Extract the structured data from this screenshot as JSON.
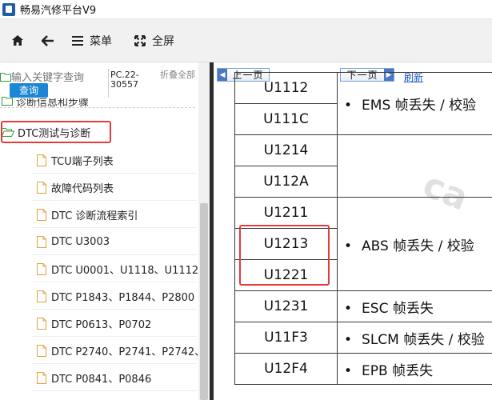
{
  "window": {
    "title": "畅易汽修平台V9"
  },
  "toolbar": {
    "menu_label": "菜单",
    "fullscreen_label": "全屏"
  },
  "search": {
    "placeholder": "输入关键字查询",
    "button_label": "查询",
    "pc_info": "PC.22-30557",
    "fold_all": "折叠全部"
  },
  "tree": {
    "partial_item": "诊断信息和步骤",
    "selected_folder": "DTC测试与诊断",
    "children": [
      "TCU端子列表",
      "故障代码列表",
      "DTC 诊断流程索引",
      "DTC U3003",
      "DTC U0001、U1118、U1112、",
      "DTC P1843、P1844、P2800",
      "DTC P0613、P0702",
      "DTC P2740、P2741、P2742、",
      "DTC P0841、P0846"
    ]
  },
  "nav": {
    "prev_label": "上一页",
    "next_label": "下一页",
    "refresh_label": "刷新"
  },
  "watermark": "ca",
  "dtc_table": {
    "groups": [
      {
        "codes": [
          "U1112",
          "U111C"
        ],
        "desc": "EMS 帧丢失 / 校验"
      },
      {
        "codes": [
          "U1214",
          "U112A"
        ],
        "desc": ""
      },
      {
        "codes": [
          "U1211",
          "U1213",
          "U1221"
        ],
        "desc": "ABS 帧丢失 / 校验"
      },
      {
        "codes": [
          "U1231"
        ],
        "desc": "ESC 帧丢失"
      },
      {
        "codes": [
          "U11F3"
        ],
        "desc": "SLCM 帧丢失 / 校验"
      },
      {
        "codes": [
          "U12F4"
        ],
        "desc": "EPB 帧丢失"
      }
    ]
  },
  "colors": {
    "accent": "#1c86d6",
    "highlight": "#e23b3b",
    "link": "#1a55c4"
  }
}
